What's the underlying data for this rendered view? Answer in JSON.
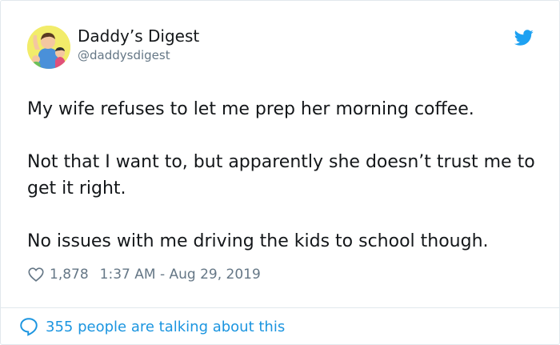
{
  "author": {
    "display_name": "Daddy’s Digest",
    "handle": "@daddysdigest",
    "avatar_icon": "cartoon-father-and-children-avatar"
  },
  "tweet": {
    "paragraphs": [
      "My wife refuses to let me prep her morning coffee.",
      "Not that I want to, but apparently she doesn’t trust me to get it right.",
      "No issues with me driving the kids to school though."
    ],
    "like_count": "1,878",
    "timestamp": "1:37 AM - Aug 29, 2019"
  },
  "footer": {
    "talking_label": "355 people are talking about this"
  },
  "icons": {
    "brand": "twitter-bird-icon",
    "like": "heart-outline-icon",
    "reply": "speech-bubble-icon"
  },
  "colors": {
    "brand_blue": "#1da1f2",
    "link_blue": "#1b95e0",
    "text_primary": "#14171a",
    "text_secondary": "#657786",
    "border": "#e1e8ed"
  }
}
